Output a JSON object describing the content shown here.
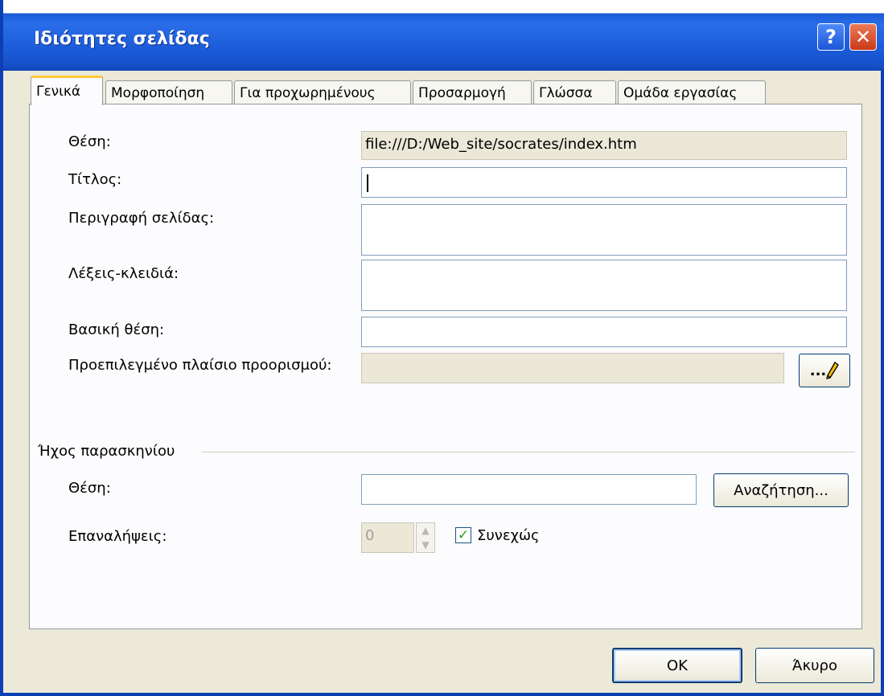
{
  "dialog": {
    "title": "Ιδιότητες σελίδας",
    "help_label": "?",
    "close_label": "✕"
  },
  "tabs": [
    {
      "label": "Γενικά",
      "active": true
    },
    {
      "label": "Μορφοποίηση",
      "active": false
    },
    {
      "label": "Για προχωρημένους",
      "active": false
    },
    {
      "label": "Προσαρμογή",
      "active": false
    },
    {
      "label": "Γλώσσα",
      "active": false
    },
    {
      "label": "Ομάδα εργασίας",
      "active": false
    }
  ],
  "general": {
    "location_label": "Θέση:",
    "location_value": "file:///D:/Web_site/socrates/index.htm",
    "title_label": "Τίτλος:",
    "title_value": "",
    "description_label": "Περιγραφή σελίδας:",
    "description_value": "",
    "keywords_label": "Λέξεις-κλειδιά:",
    "keywords_value": "",
    "base_label": "Βασική θέση:",
    "base_value": "",
    "target_frame_label": "Προεπιλεγμένο πλαίσιο προορισμού:",
    "target_frame_value": "",
    "target_frame_button": "..."
  },
  "background_sound": {
    "group_label": "Ήχος παρασκηνίου",
    "location_label": "Θέση:",
    "location_value": "",
    "browse_button": "Αναζήτηση...",
    "loop_label": "Επαναλήψεις:",
    "loop_value": "0",
    "forever_label": "Συνεχώς",
    "forever_checked": true
  },
  "footer": {
    "ok": "OK",
    "cancel": "Άκυρο"
  }
}
